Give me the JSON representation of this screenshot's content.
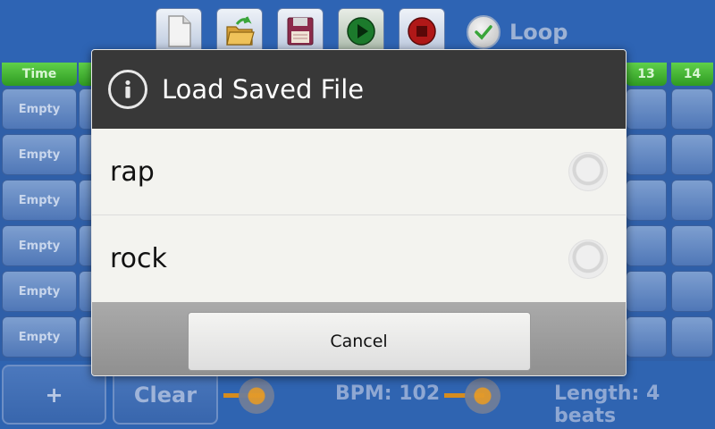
{
  "toolbar": {
    "buttons": [
      {
        "name": "new-file",
        "icon": "blank-document-icon"
      },
      {
        "name": "open-file",
        "icon": "folder-open-icon"
      },
      {
        "name": "save-file",
        "icon": "floppy-disk-icon"
      },
      {
        "name": "play",
        "icon": "play-icon"
      },
      {
        "name": "stop",
        "icon": "stop-icon"
      }
    ],
    "loop_label": "Loop"
  },
  "grid": {
    "left_header": "Time",
    "right_headers": [
      "13",
      "14"
    ],
    "empty_label": "Empty"
  },
  "bottom": {
    "add_label": "+",
    "clear_label": "Clear",
    "bpm_label": "BPM: 102",
    "length_label": "Length: 4 beats"
  },
  "dialog": {
    "title": "Load Saved File",
    "icon": "info-icon",
    "options": [
      {
        "label": "rap",
        "selected": false
      },
      {
        "label": "rock",
        "selected": false
      }
    ],
    "cancel_label": "Cancel"
  },
  "colors": {
    "background_blue": "#2e64b4",
    "header_green": "#3db22d",
    "dialog_header": "#383838",
    "dialog_body": "#f3f3ef",
    "slider_orange": "#d58c1e"
  }
}
